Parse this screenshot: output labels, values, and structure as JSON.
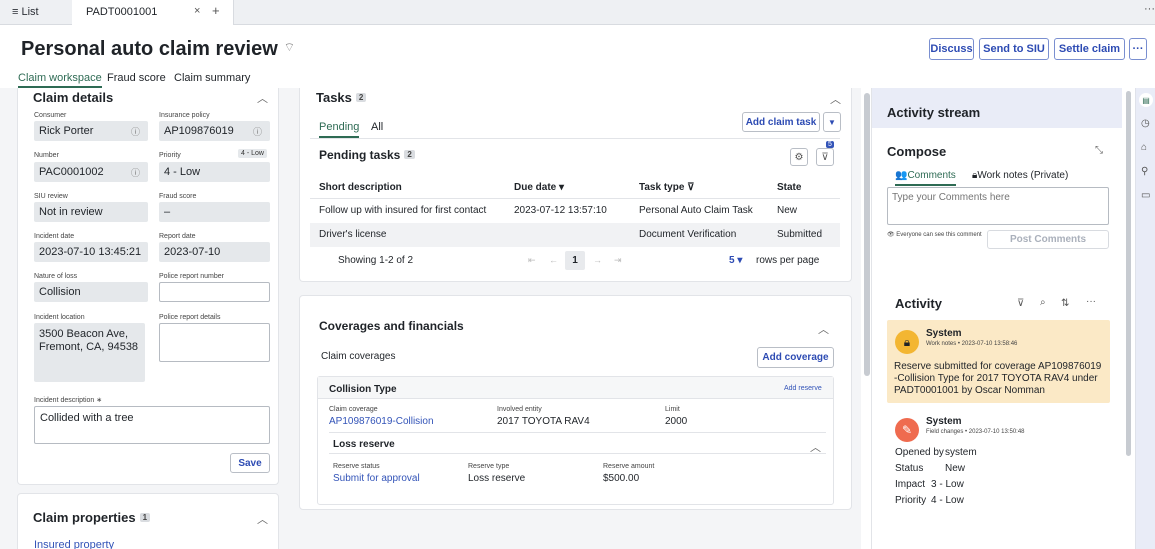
{
  "tabbar": {
    "list_label": "≡ List",
    "tab_title": "PADT0001001",
    "close": "×",
    "new_tab": "+",
    "more": "···"
  },
  "header": {
    "title": "Personal auto claim review",
    "tag_icon": "tag-icon",
    "buttons": {
      "discuss": "Discuss",
      "siu": "Send to SIU",
      "settle": "Settle claim",
      "more": "···"
    }
  },
  "page_tabs": [
    "Claim workspace",
    "Fraud score",
    "Claim summary"
  ],
  "claim_details": {
    "title": "Claim details",
    "fields": {
      "consumer": {
        "label": "Consumer",
        "value": "Rick Porter"
      },
      "policy": {
        "label": "Insurance policy",
        "value": "AP109876019"
      },
      "number": {
        "label": "Number",
        "value": "PAC0001002"
      },
      "priority": {
        "label": "Priority",
        "value": "4 - Low",
        "badge": "4 - Low"
      },
      "siu": {
        "label": "SIU review",
        "value": "Not in review"
      },
      "fraud": {
        "label": "Fraud score",
        "value": "–"
      },
      "incident_date": {
        "label": "Incident date",
        "value": "2023-07-10 13:45:21"
      },
      "report_date": {
        "label": "Report date",
        "value": "2023-07-10"
      },
      "nature": {
        "label": "Nature of loss",
        "value": "Collision"
      },
      "police_number": {
        "label": "Police report number",
        "value": ""
      },
      "location": {
        "label": "Incident location",
        "value": "3500 Beacon Ave, Fremont, CA, 94538"
      },
      "police_details": {
        "label": "Police report details",
        "value": ""
      },
      "description": {
        "label": "Incident description ∗",
        "value": "Collided with a tree"
      }
    },
    "save": "Save"
  },
  "claim_properties": {
    "title": "Claim properties",
    "count": "1",
    "link": "Insured property"
  },
  "tasks": {
    "title": "Tasks",
    "count": "2",
    "subtabs": [
      "Pending",
      "All"
    ],
    "add_button": "Add claim task",
    "pending_title": "Pending tasks",
    "pending_count": "2",
    "filter_badge": "5",
    "columns": [
      "Short description",
      "Due date ▾",
      "Task type ⊽",
      "State"
    ],
    "rows": [
      {
        "desc": "Follow up with insured for first contact",
        "due": "2023-07-12 13:57:10",
        "type": "Personal Auto Claim Task",
        "state": "New"
      },
      {
        "desc": "Driver's license",
        "due": "",
        "type": "Document Verification",
        "state": "Submitted"
      }
    ],
    "pagination": {
      "showing": "Showing 1-2 of 2",
      "page": "1",
      "per_page": "5 ▾",
      "rows_label": "rows per page"
    }
  },
  "coverages": {
    "title": "Coverages and financials",
    "claim_coverages": "Claim coverages",
    "add_coverage": "Add coverage",
    "coverage": {
      "type": "Collision Type",
      "add_reserve": "Add reserve",
      "claim_coverage_label": "Claim coverage",
      "claim_coverage_value": "AP109876019-Collision",
      "entity_label": "Involved entity",
      "entity_value": "2017 TOYOTA RAV4",
      "limit_label": "Limit",
      "limit_value": "2000"
    },
    "loss_reserve": {
      "title": "Loss reserve",
      "status_label": "Reserve status",
      "status_value": "Submit for approval",
      "type_label": "Reserve type",
      "type_value": "Loss reserve",
      "amount_label": "Reserve amount",
      "amount_value": "$500.00"
    }
  },
  "activity_stream": {
    "title": "Activity stream",
    "compose_title": "Compose",
    "compose_tabs": [
      "Comments",
      "Work notes (Private)"
    ],
    "placeholder": "Type your Comments here",
    "visibility": "Everyone can see this comment",
    "post": "Post Comments",
    "activity_title": "Activity",
    "entries": [
      {
        "author": "System",
        "meta": "Work notes • 2023-07-10 13:58:46",
        "text": "Reserve submitted for coverage AP109876019-Collision Type for 2017 TOYOTA RAV4 under PADT0001001 by Oscar Nomman"
      },
      {
        "author": "System",
        "meta": "Field changes • 2023-07-10 13:50:48",
        "fields": [
          {
            "k": "Opened by",
            "v": "system"
          },
          {
            "k": "Status",
            "v": "New"
          },
          {
            "k": "Impact",
            "v": "3 - Low"
          },
          {
            "k": "Priority",
            "v": "4 - Low"
          }
        ]
      }
    ]
  },
  "colors": {
    "accent": "#2d4bb3",
    "green": "#2e6b54",
    "worknote": "#fbe9c6",
    "system_avatar": "#f3b632",
    "field_avatar": "#ef6b4f"
  }
}
